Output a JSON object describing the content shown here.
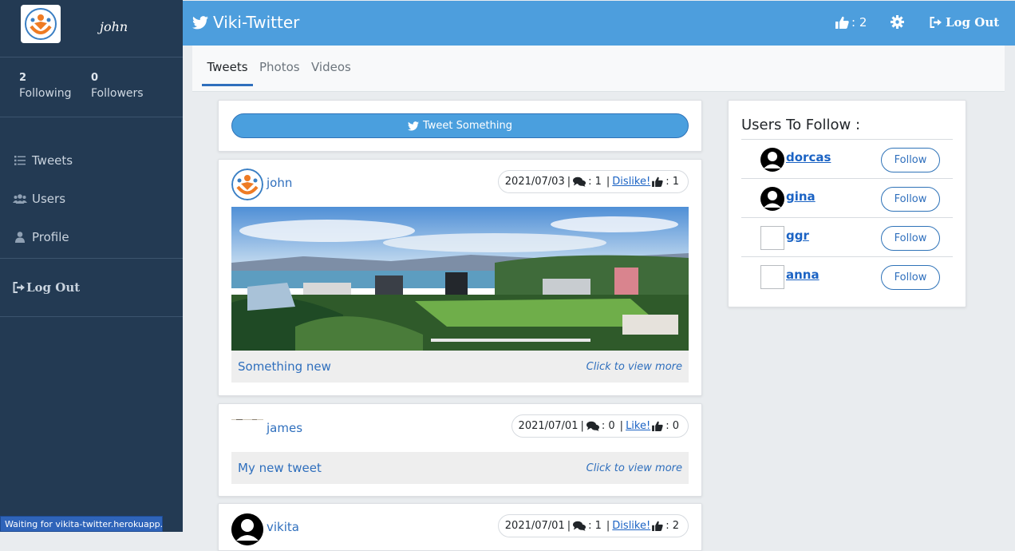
{
  "sidebar": {
    "username": "john",
    "stats": [
      {
        "value": "2",
        "label": "Following"
      },
      {
        "value": "0",
        "label": "Followers"
      }
    ],
    "nav": [
      {
        "label": "Tweets",
        "icon": "list-icon"
      },
      {
        "label": "Users",
        "icon": "users-icon"
      },
      {
        "label": "Profile",
        "icon": "user-icon"
      }
    ],
    "logout_label": "Log Out"
  },
  "header": {
    "brand": "Viki-Twitter",
    "likes_count": ": 2",
    "logout_label": "Log Out"
  },
  "tabs": [
    {
      "label": "Tweets",
      "active": true
    },
    {
      "label": "Photos",
      "active": false
    },
    {
      "label": "Videos",
      "active": false
    }
  ],
  "compose": {
    "button_label": "Tweet Something"
  },
  "tweets": [
    {
      "user": "john",
      "date": "2021/07/03",
      "comments": ": 1",
      "reaction_label": "Dislike!",
      "likes": ": 1",
      "text": "Something new",
      "more": "Click to view more"
    },
    {
      "user": "james",
      "date": "2021/07/01",
      "comments": ": 0",
      "reaction_label": "Like!",
      "likes": ": 0",
      "text": "My new tweet",
      "more": "Click to view more"
    },
    {
      "user": "vikita",
      "date": "2021/07/01",
      "comments": ": 1",
      "reaction_label": "Dislike!",
      "likes": ": 2"
    }
  ],
  "users_to_follow": {
    "title": "Users To Follow :",
    "follow_label": "Follow",
    "users": [
      {
        "name": "dorcas",
        "avatar": "silhouette"
      },
      {
        "name": "gina",
        "avatar": "silhouette"
      },
      {
        "name": "ggr",
        "avatar": "broken-image"
      },
      {
        "name": "anna",
        "avatar": "broken-image"
      }
    ]
  },
  "status_bar": "Waiting for vikita-twitter.herokuapp...",
  "colors": {
    "header": "#4d9edd",
    "sidebar": "#233a53",
    "link": "#2f6fbd"
  }
}
